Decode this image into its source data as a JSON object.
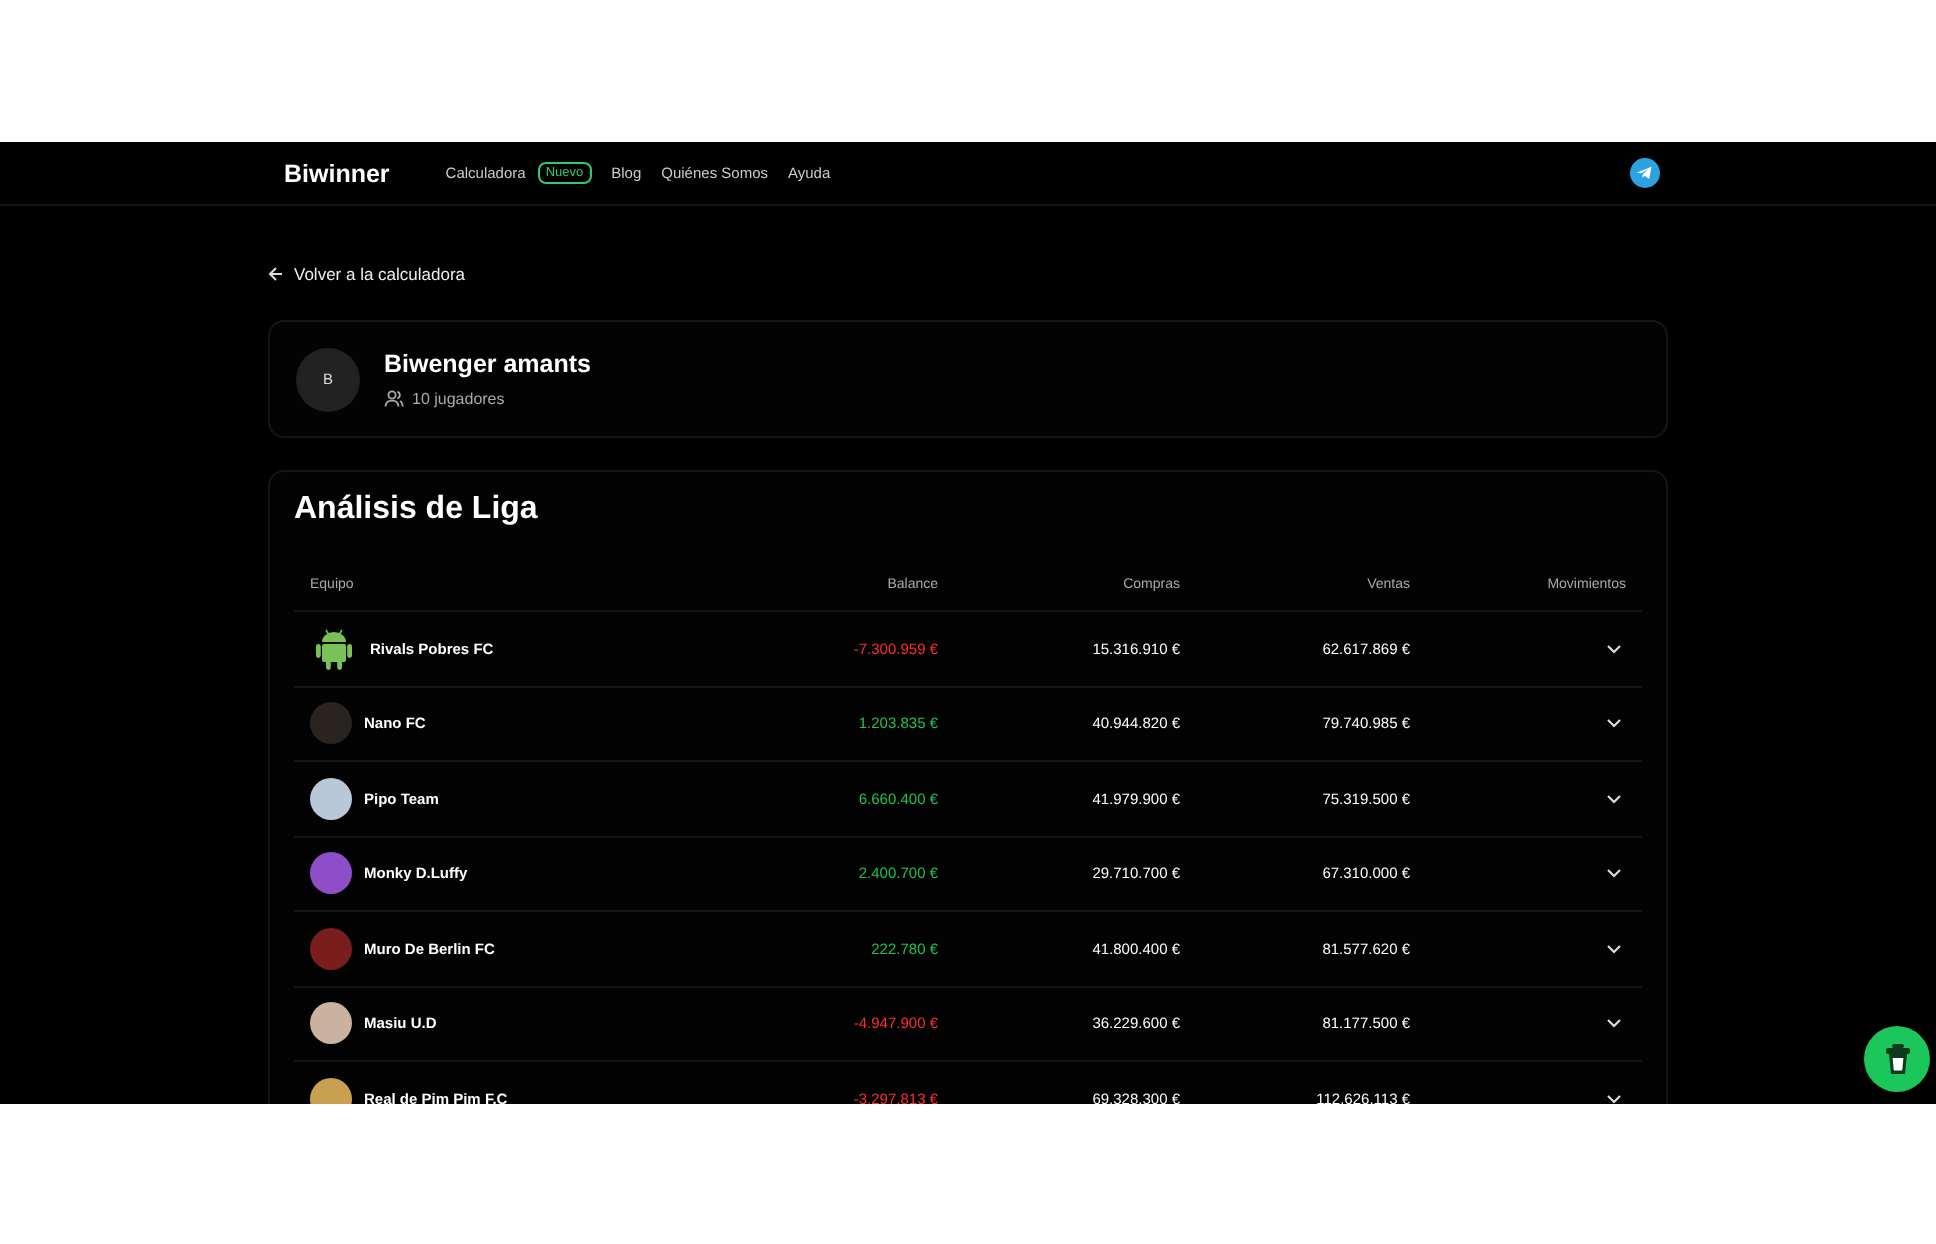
{
  "nav": {
    "logo": "Biwinner",
    "links": [
      {
        "label": "Calculadora",
        "badge": "Nuevo"
      },
      {
        "label": "Blog"
      },
      {
        "label": "Quiénes Somos"
      },
      {
        "label": "Ayuda"
      }
    ]
  },
  "back_link": "Volver a la calculadora",
  "league": {
    "initial": "B",
    "name": "Biwenger amants",
    "players": "10 jugadores"
  },
  "analysis": {
    "title": "Análisis de Liga",
    "columns": [
      "Equipo",
      "Balance",
      "Compras",
      "Ventas",
      "Movimientos"
    ],
    "rows": [
      {
        "team": "Rivals Pobres FC",
        "kind": "android",
        "balance": "-7.300.959 €",
        "negative": true,
        "compras": "15.316.910 €",
        "ventas": "62.617.869 €",
        "expanded": false
      },
      {
        "team": "Nano FC",
        "kind": "photo",
        "balance": "1.203.835 €",
        "negative": false,
        "compras": "40.944.820 €",
        "ventas": "79.740.985 €",
        "expanded": false
      },
      {
        "team": "Pipo Team",
        "kind": "photo",
        "balance": "6.660.400 €",
        "negative": false,
        "compras": "41.979.900 €",
        "ventas": "75.319.500 €",
        "expanded": false
      },
      {
        "team": "Monky D.Luffy",
        "kind": "photo",
        "balance": "2.400.700 €",
        "negative": false,
        "compras": "29.710.700 €",
        "ventas": "67.310.000 €",
        "expanded": false
      },
      {
        "team": "Muro De Berlin FC",
        "kind": "photo",
        "balance": "222.780 €",
        "negative": false,
        "compras": "41.800.400 €",
        "ventas": "81.577.620 €",
        "expanded": false
      },
      {
        "team": "Masiu U.D",
        "kind": "photo",
        "balance": "-4.947.900 €",
        "negative": true,
        "compras": "36.229.600 €",
        "ventas": "81.177.500 €",
        "expanded": false
      },
      {
        "team": "Real de Pim Pim F.C",
        "kind": "photo",
        "balance": "-3.297.813 €",
        "negative": true,
        "compras": "69.328.300 €",
        "ventas": "112.626.113 €",
        "expanded": false
      }
    ]
  }
}
